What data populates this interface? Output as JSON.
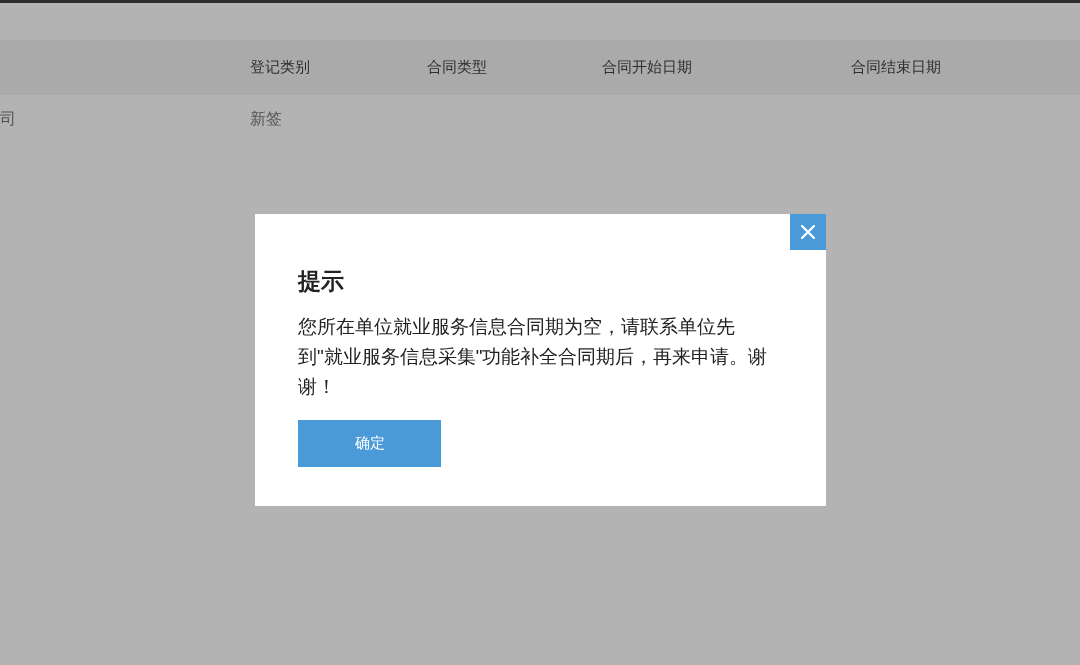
{
  "table": {
    "columns": [
      {},
      {
        "label": "登记类别"
      },
      {
        "label": "合同类型"
      },
      {
        "label": "合同开始日期"
      },
      {
        "label": "合同结束日期"
      }
    ],
    "rows": [
      {
        "cells": [
          "司",
          "新签"
        ]
      }
    ]
  },
  "dialog": {
    "title": "提示",
    "message": "您所在单位就业服务信息合同期为空，请联系单位先到\"就业服务信息采集\"功能补全合同期后，再来申请。谢谢！",
    "buttons": [
      {
        "label": "确定"
      }
    ]
  }
}
